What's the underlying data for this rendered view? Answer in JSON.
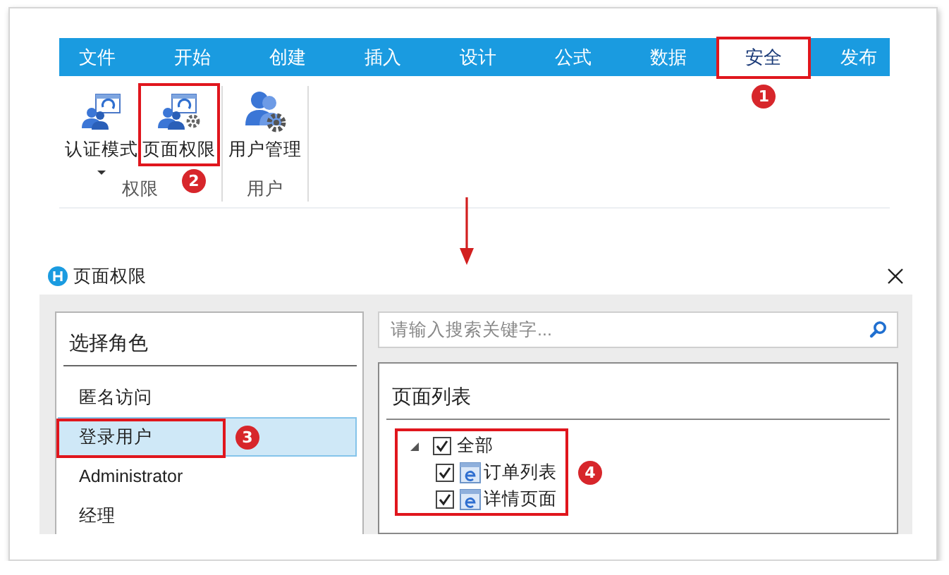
{
  "ribbon": {
    "tabs": [
      {
        "label": "文件",
        "selected": false
      },
      {
        "label": "开始",
        "selected": false
      },
      {
        "label": "创建",
        "selected": false
      },
      {
        "label": "插入",
        "selected": false
      },
      {
        "label": "设计",
        "selected": false
      },
      {
        "label": "公式",
        "selected": false
      },
      {
        "label": "数据",
        "selected": false
      },
      {
        "label": "安全",
        "selected": true,
        "callout": "1"
      },
      {
        "label": "发布",
        "selected": false
      }
    ],
    "groups": [
      {
        "label": "权限",
        "buttons": [
          {
            "label": "认证模式",
            "dropdown": true
          },
          {
            "label": "页面权限",
            "dropdown": false,
            "callout": "2"
          }
        ]
      },
      {
        "label": "用户",
        "buttons": [
          {
            "label": "用户管理",
            "dropdown": false
          }
        ]
      }
    ]
  },
  "dialog": {
    "title": "页面权限",
    "roles": {
      "title": "选择角色",
      "items": [
        {
          "label": "匿名访问",
          "selected": false
        },
        {
          "label": "登录用户",
          "selected": true,
          "callout": "3"
        },
        {
          "label": "Administrator",
          "selected": false
        },
        {
          "label": "经理",
          "selected": false
        }
      ]
    },
    "search": {
      "placeholder": "请输入搜索关键字..."
    },
    "page_list": {
      "title": "页面列表",
      "callout": "4",
      "tree": [
        {
          "label": "全部",
          "checked": true,
          "expanded": true,
          "children": [
            {
              "label": "订单列表",
              "checked": true
            },
            {
              "label": "详情页面",
              "checked": true
            }
          ]
        }
      ]
    }
  }
}
